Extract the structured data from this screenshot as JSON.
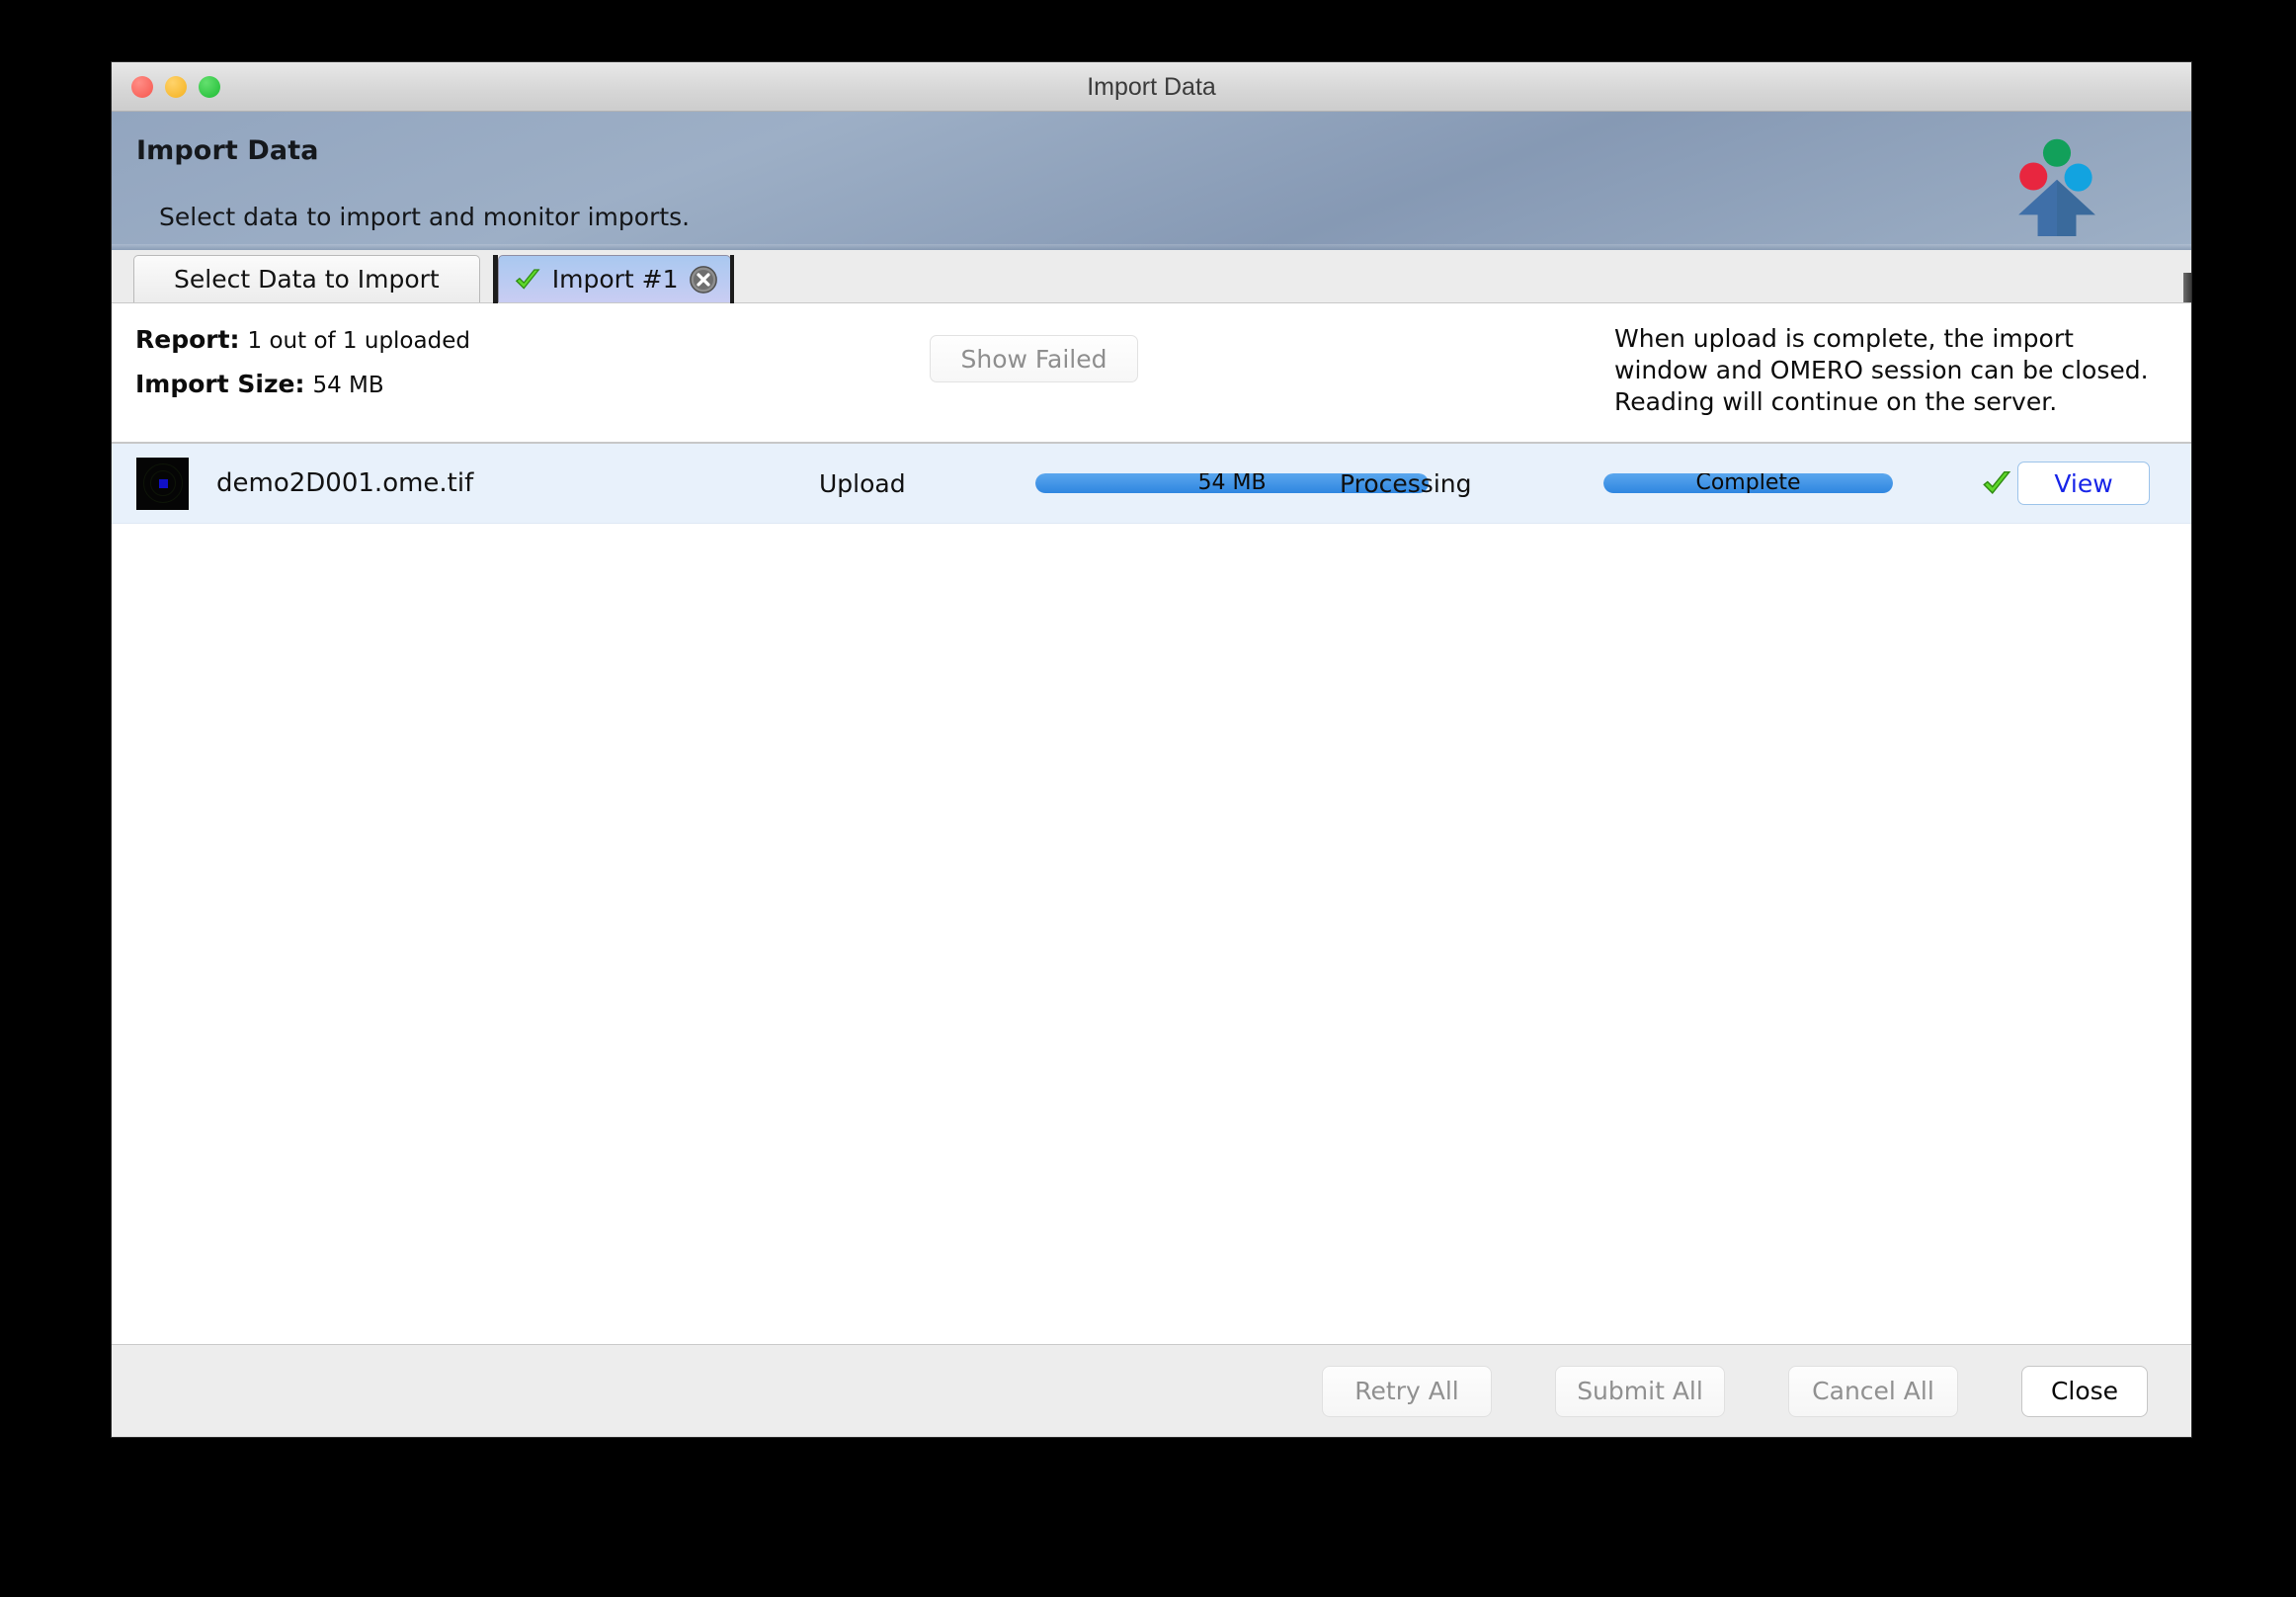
{
  "window": {
    "title": "Import Data",
    "traffic_lights": [
      {
        "name": "close",
        "color": "#f6564d"
      },
      {
        "name": "minimize",
        "color": "#f4b01e"
      },
      {
        "name": "zoom",
        "color": "#1dbb33"
      }
    ]
  },
  "banner": {
    "title": "Import Data",
    "subtitle": "Select data to import and monitor imports.",
    "logo_icon": "omero-import-upload-icon",
    "logo_colors": {
      "arrow": "#3f6fa8",
      "circle_top": "#12a05a",
      "circle_left": "#e8263f",
      "circle_right": "#12a3e0"
    }
  },
  "tabs": [
    {
      "label": "Select Data to Import",
      "active": false,
      "closable": false,
      "icon": null
    },
    {
      "label": "Import #1",
      "active": true,
      "closable": true,
      "icon": "green-check-icon",
      "close_icon": "close-circle-icon"
    }
  ],
  "report": {
    "report_label": "Report:",
    "report_value": "1 out of 1 uploaded",
    "size_label": "Import Size:",
    "size_value": "54 MB",
    "show_failed_label": "Show Failed",
    "show_failed_enabled": false,
    "note": "When upload is complete, the import window and OMERO session can be closed. Reading will continue on the server."
  },
  "file_rows": [
    {
      "thumbnail_icon": "image-thumbnail",
      "filename": "demo2D001.ome.tif",
      "upload_label": "Upload",
      "upload_progress_text": "54 MB",
      "upload_percent": 100,
      "processing_label": "Processing",
      "processing_progress_text": "Complete",
      "processing_percent": 100,
      "status_icon": "green-check-icon",
      "view_label": "View"
    }
  ],
  "footer": {
    "buttons": [
      {
        "label": "Retry All",
        "enabled": false
      },
      {
        "label": "Submit All",
        "enabled": false
      },
      {
        "label": "Cancel All",
        "enabled": false
      },
      {
        "label": "Close",
        "enabled": true
      }
    ]
  },
  "colors": {
    "accent_blue": "#2f86e0",
    "row_background": "#e8f1fb",
    "banner_gradient_start": "#92a5bf",
    "banner_gradient_end": "#9eb0c6",
    "active_tab_start": "#a9c8f0",
    "active_tab_end": "#c9cdf3",
    "view_text": "#1724e8"
  }
}
